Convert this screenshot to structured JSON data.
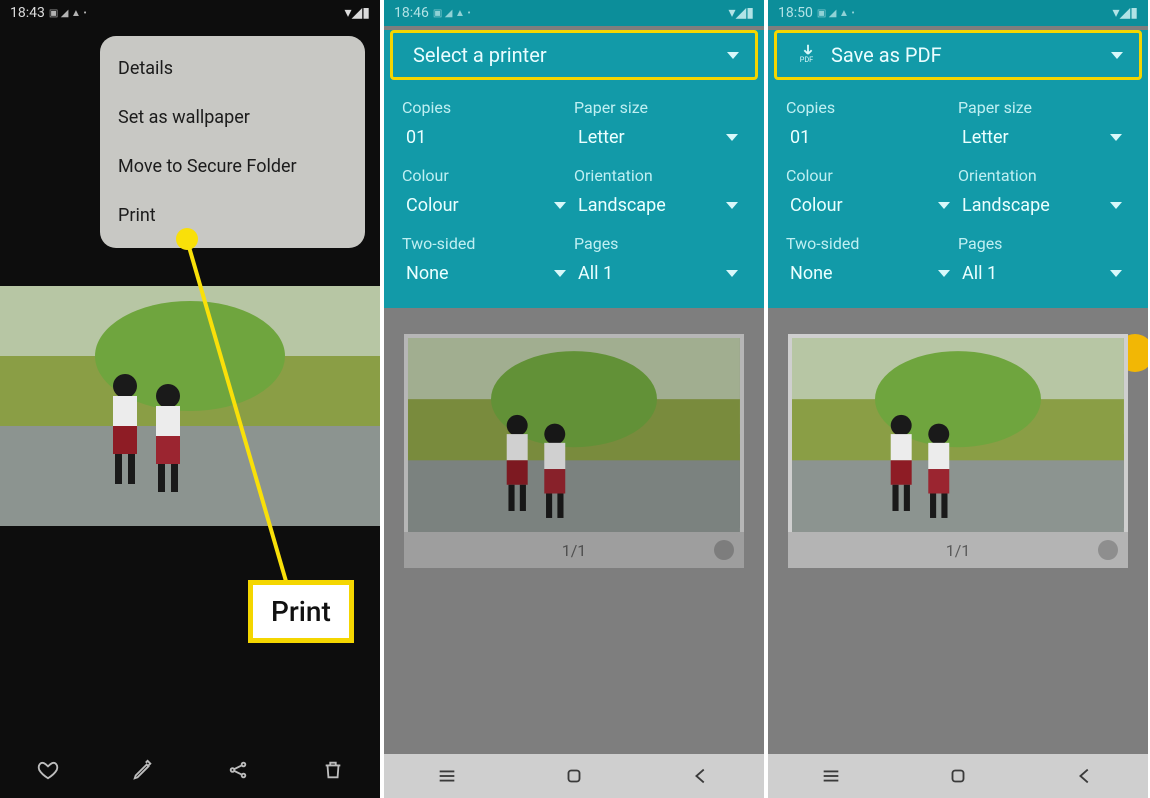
{
  "phone1": {
    "time": "18:43",
    "menu": {
      "details": "Details",
      "wallpaper": "Set as wallpaper",
      "secure": "Move to Secure Folder",
      "print": "Print"
    },
    "annotation_label": "Print"
  },
  "phone2": {
    "time": "18:46",
    "printer_label": "Select a printer",
    "page_count": "1/1"
  },
  "phone3": {
    "time": "18:50",
    "printer_label": "Save as PDF",
    "page_count": "1/1"
  },
  "print_opts": {
    "copies_lbl": "Copies",
    "copies_val": "01",
    "paper_lbl": "Paper size",
    "paper_val": "Letter",
    "colour_lbl": "Colour",
    "colour_val": "Colour",
    "orient_lbl": "Orientation",
    "orient_val": "Landscape",
    "twosided_lbl": "Two-sided",
    "twosided_val": "None",
    "pages_lbl": "Pages",
    "pages_val": "All 1"
  }
}
